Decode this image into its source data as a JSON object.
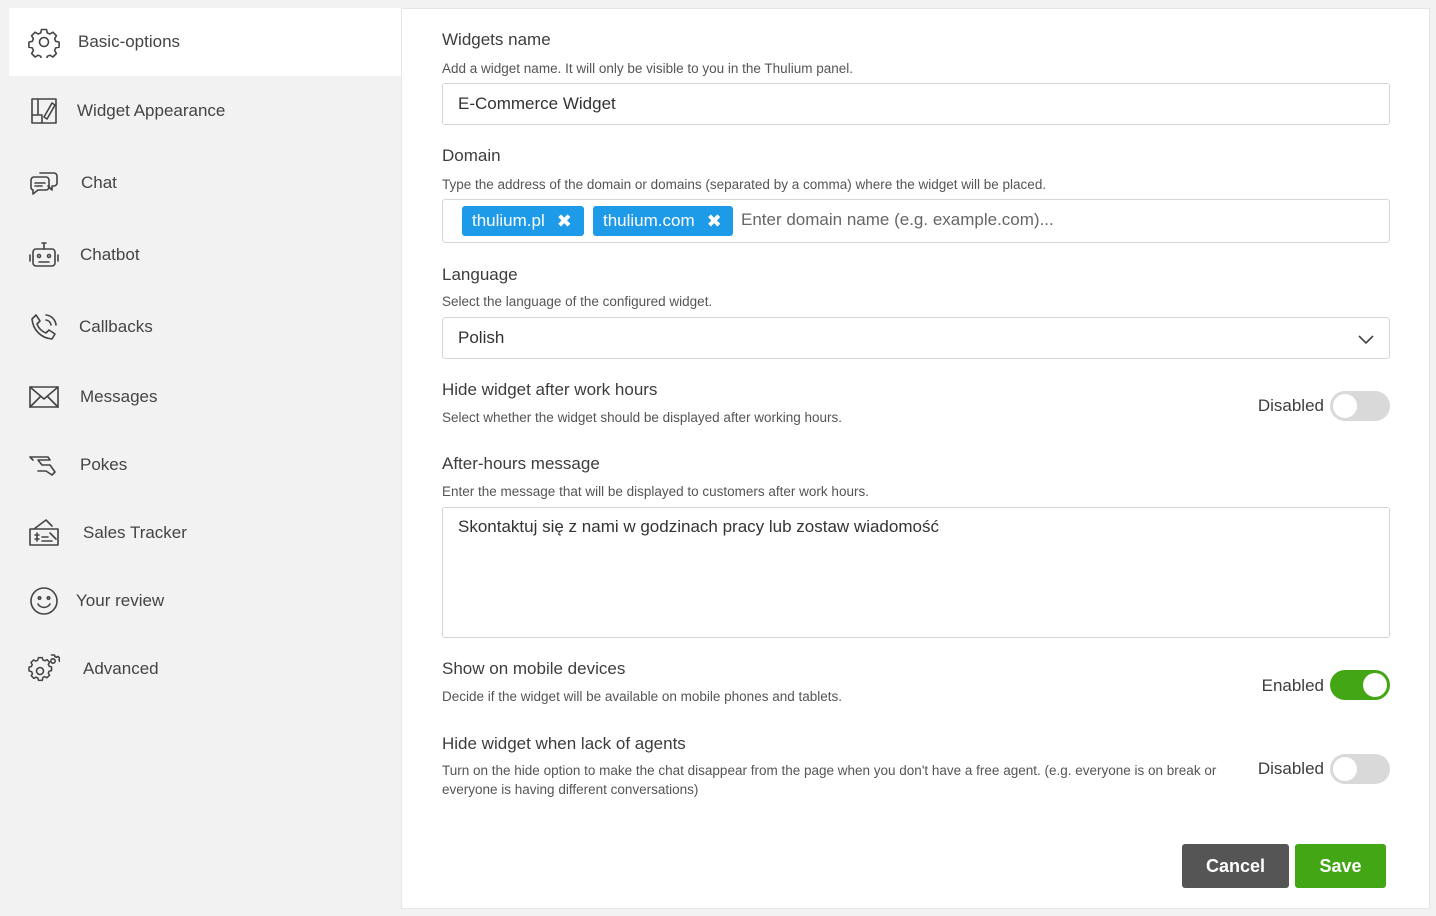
{
  "sidebar": {
    "items": [
      {
        "label": "Basic-options",
        "icon": "gear-icon"
      },
      {
        "label": "Widget Appearance",
        "icon": "appearance-icon"
      },
      {
        "label": "Chat",
        "icon": "chat-bubbles-icon"
      },
      {
        "label": "Chatbot",
        "icon": "robot-icon"
      },
      {
        "label": "Callbacks",
        "icon": "phone-call-icon"
      },
      {
        "label": "Messages",
        "icon": "envelope-icon"
      },
      {
        "label": "Pokes",
        "icon": "poke-hand-icon"
      },
      {
        "label": "Sales Tracker",
        "icon": "sales-tracker-icon"
      },
      {
        "label": "Your review",
        "icon": "smiley-icon"
      },
      {
        "label": "Advanced",
        "icon": "gears-icon"
      }
    ],
    "active": "Basic-options"
  },
  "form": {
    "widget_name": {
      "title": "Widgets name",
      "description": "Add a widget name. It will only be visible to you in the Thulium panel.",
      "value": "E-Commerce Widget"
    },
    "domain": {
      "title": "Domain",
      "description": "Type the address of the domain or domains (separated by a comma) where the widget will be placed.",
      "tags": [
        "thulium.pl",
        "thulium.com"
      ],
      "tag_remove_symbol": "✖",
      "placeholder": "Enter domain name (e.g. example.com)..."
    },
    "language": {
      "title": "Language",
      "description": "Select the language of the configured widget.",
      "value": "Polish"
    },
    "hide_after_hours": {
      "title": "Hide widget after work hours",
      "description": "Select whether the widget should be displayed after working hours.",
      "state_label": "Disabled",
      "enabled": false
    },
    "after_hours_message": {
      "title": "After-hours message",
      "description": "Enter the message that will be displayed to customers after work hours.",
      "value": "Skontaktuj się z nami w godzinach pracy lub zostaw wiadomość"
    },
    "show_mobile": {
      "title": "Show on mobile devices",
      "description": "Decide if the widget will be available on mobile phones and tablets.",
      "state_label": "Enabled",
      "enabled": true
    },
    "hide_no_agents": {
      "title": "Hide widget when lack of agents",
      "description": "Turn on the hide option to make the chat disappear from the page when you don't have a free agent. (e.g. everyone is on break or everyone is having different conversations)",
      "state_label": "Disabled",
      "enabled": false
    }
  },
  "buttons": {
    "cancel": "Cancel",
    "save": "Save"
  },
  "colors": {
    "accent_blue": "#1e9be8",
    "accent_green": "#43a615",
    "cancel_gray": "#555555"
  }
}
